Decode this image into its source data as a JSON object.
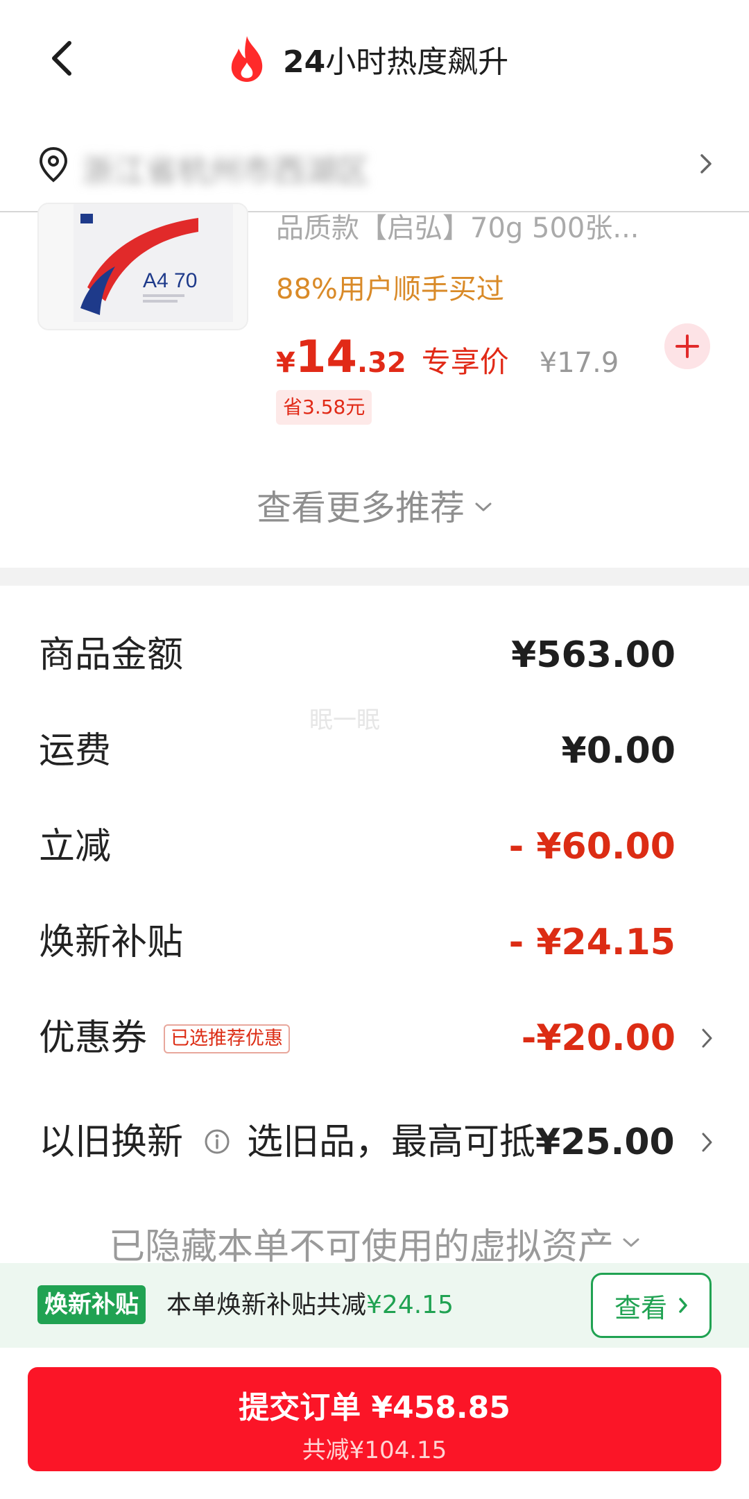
{
  "header": {
    "title_prefix": "24",
    "title_suffix": "小时热度飙升"
  },
  "address": {
    "text": "浙江省杭州市西湖区"
  },
  "product": {
    "name": "品质款【启弘】70g 500张...",
    "bought_note": "88%用户顺手买过",
    "currency": "¥",
    "price_int": "14",
    "price_dec": ".32",
    "price_tag": "专享价",
    "original_price": "¥17.9",
    "save_badge": "省3.58元",
    "image_label": "A4 70"
  },
  "more": {
    "label": "查看更多推荐"
  },
  "summary": {
    "goods_amount": {
      "label": "商品金额",
      "value": "¥563.00"
    },
    "shipping": {
      "label": "运费",
      "value": "¥0.00"
    },
    "instant_discount": {
      "label": "立减",
      "value": "- ¥60.00"
    },
    "renew_subsidy": {
      "label": "焕新补贴",
      "value": "- ¥24.15"
    },
    "coupon": {
      "label": "优惠券",
      "badge": "已选推荐优惠",
      "value": "-¥20.00"
    },
    "trade_in": {
      "label": "以旧换新",
      "text_prefix": "选旧品，最高可抵",
      "text_amount": "¥25.00"
    }
  },
  "hidden_assets": {
    "label": "已隐藏本单不可使用的虚拟资产"
  },
  "watermark": "眠一眠",
  "banner": {
    "tag": "焕新补贴",
    "text": "本单焕新补贴共减",
    "amount": "¥24.15",
    "button": "查看"
  },
  "submit": {
    "label": "提交订单 ¥458.85",
    "sub": "共减¥104.15"
  },
  "colors": {
    "accent_red": "#fb1527",
    "price_red": "#e12a17",
    "green": "#20a252",
    "orange": "#d98a28"
  }
}
